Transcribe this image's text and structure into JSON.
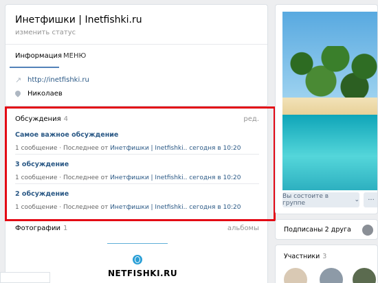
{
  "group": {
    "title": "Инетфишки | Inetfishki.ru",
    "status_placeholder": "изменить статус"
  },
  "tabs": [
    {
      "label": "Информация"
    },
    {
      "label": "МЕНЮ"
    }
  ],
  "info": {
    "site": "http://inetfishki.ru",
    "city": "Николаев"
  },
  "discussions": {
    "header": "Обсуждения",
    "count": "4",
    "edit": "ред.",
    "topics": [
      {
        "title": "Самое важное обсуждение",
        "count": "1 сообщение",
        "sep": "·",
        "last_label": "Последнее от",
        "author": "Инетфишки | Inetfishki..",
        "time": "сегодня в 10:20"
      },
      {
        "title": "3 обсуждение",
        "count": "1 сообщение",
        "sep": "·",
        "last_label": "Последнее от",
        "author": "Инетфишки | Inetfishki..",
        "time": "сегодня в 10:20"
      },
      {
        "title": "2 обсуждение",
        "count": "1 сообщение",
        "sep": "·",
        "last_label": "Последнее от",
        "author": "Инетфишки | Inetfishki..",
        "time": "сегодня в 10:20"
      }
    ]
  },
  "photos": {
    "header": "Фотографии",
    "count": "1",
    "albums": "альбомы",
    "banner_text": "NETFISHKI.RU"
  },
  "sidebar": {
    "join_label": "Вы состоите в группе",
    "join_caret": "⌄",
    "more_label": "···",
    "friends_text": "Подписаны 2 друга",
    "members_header": "Участники",
    "members_count": "3"
  },
  "colors": {
    "accent": "#2a5885",
    "highlight_frame": "#e30613"
  },
  "icons": {
    "site": "share-arrow-icon",
    "city": "location-pin-icon",
    "banner": "globe-icon"
  }
}
